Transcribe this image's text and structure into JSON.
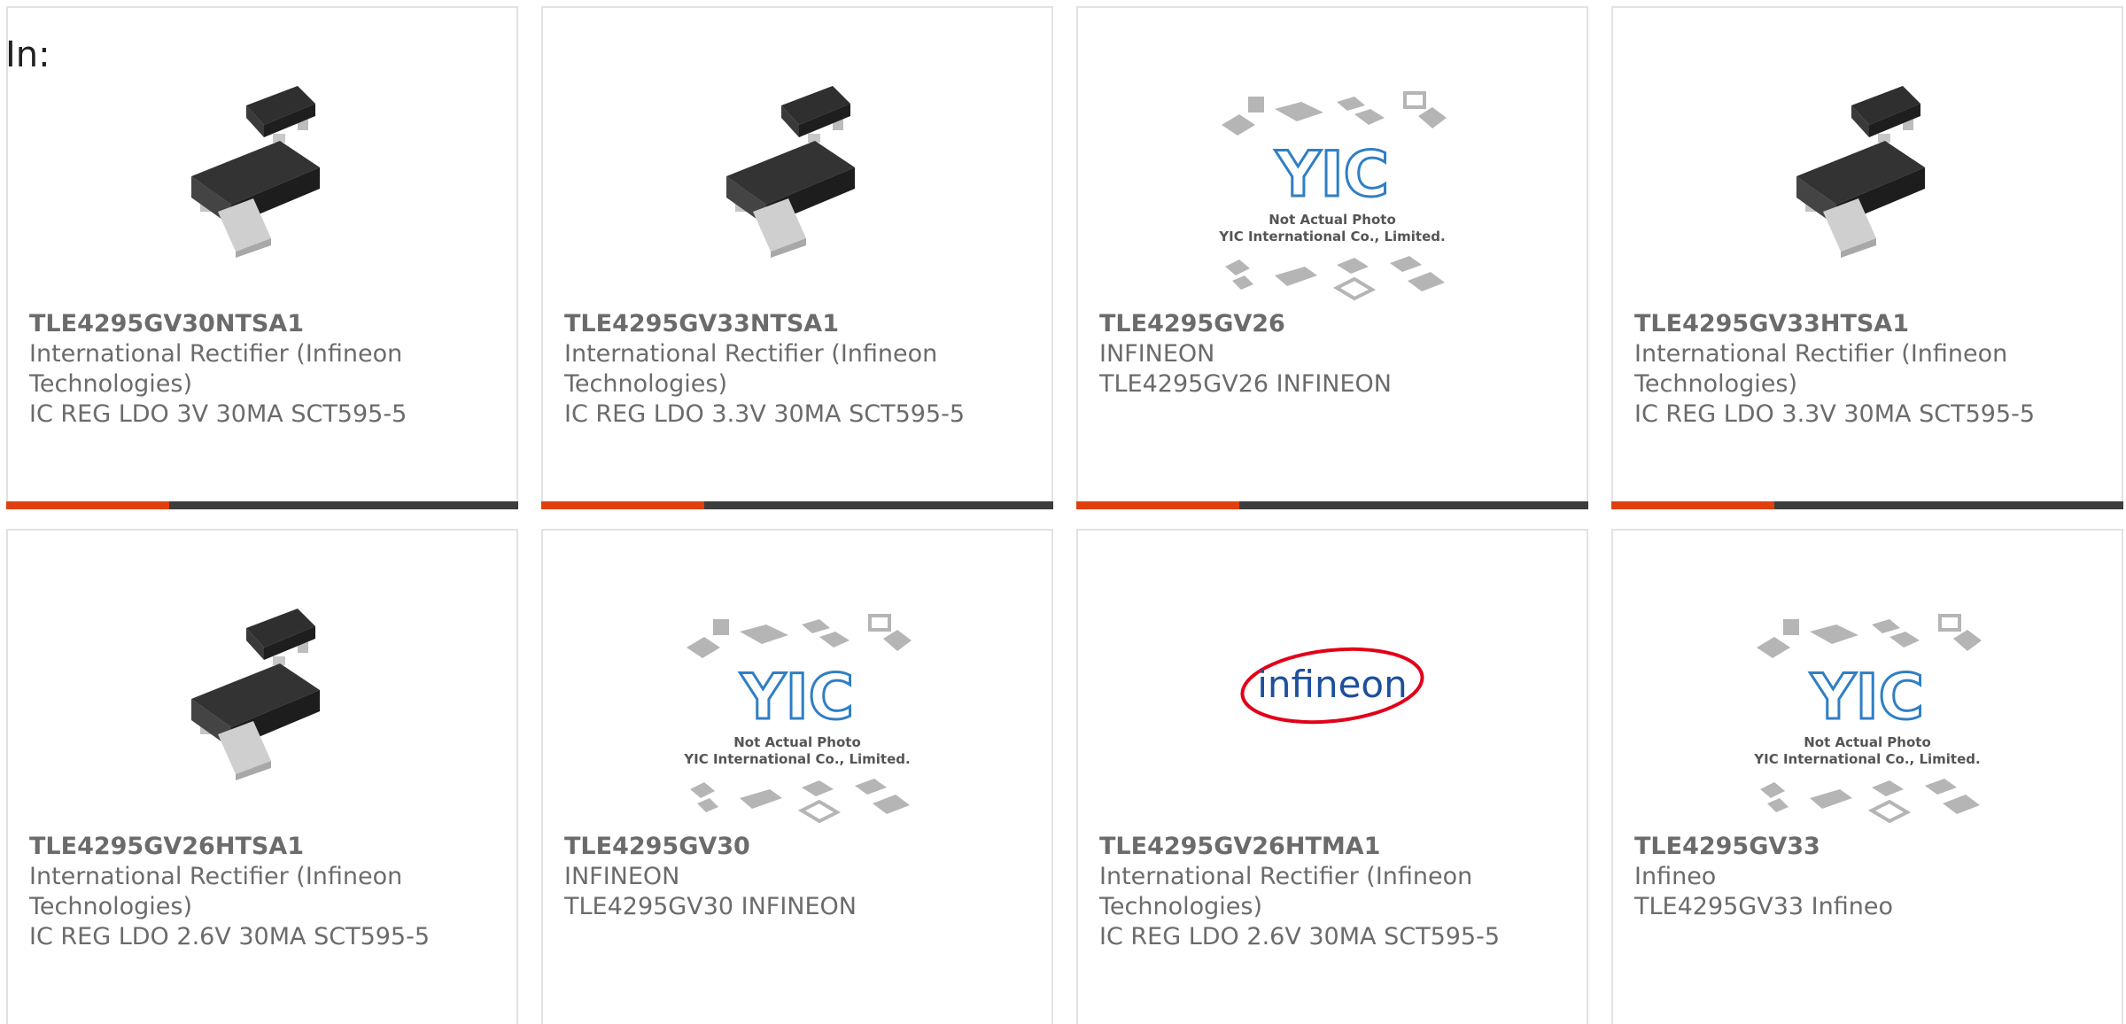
{
  "header": {
    "label": "In:"
  },
  "colors": {
    "accent": "#e0400f",
    "bar": "#3d3d3d",
    "text": "#6b6b6b"
  },
  "cards": [
    {
      "part": "TLE4295GV30NTSA1",
      "manufacturer": "International Rectifier (Infineon Technologies)",
      "description": "IC REG LDO 3V 30MA SCT595-5",
      "image": "sct595-package-photo"
    },
    {
      "part": "TLE4295GV33NTSA1",
      "manufacturer": "International Rectifier (Infineon Technologies)",
      "description": "IC REG LDO 3.3V 30MA SCT595-5",
      "image": "sct595-package-photo"
    },
    {
      "part": "TLE4295GV26",
      "manufacturer": "INFINEON",
      "description": "TLE4295GV26 INFINEON",
      "image": "yic-placeholder",
      "placeholder_line1": "Not Actual Photo",
      "placeholder_line2": "YIC International Co., Limited."
    },
    {
      "part": "TLE4295GV33HTSA1",
      "manufacturer": "International Rectifier (Infineon Technologies)",
      "description": "IC REG LDO 3.3V 30MA SCT595-5",
      "image": "sct595-package-photo"
    },
    {
      "part": "TLE4295GV26HTSA1",
      "manufacturer": "International Rectifier (Infineon Technologies)",
      "description": "IC REG LDO 2.6V 30MA SCT595-5",
      "image": "sct595-package-photo"
    },
    {
      "part": "TLE4295GV30",
      "manufacturer": "INFINEON",
      "description": "TLE4295GV30 INFINEON",
      "image": "yic-placeholder",
      "placeholder_line1": "Not Actual Photo",
      "placeholder_line2": "YIC International Co., Limited."
    },
    {
      "part": "TLE4295GV26HTMA1",
      "manufacturer": "International Rectifier (Infineon Technologies)",
      "description": "IC REG LDO 2.6V 30MA SCT595-5",
      "image": "infineon-logo",
      "logo_text": "infineon"
    },
    {
      "part": "TLE4295GV33",
      "manufacturer": "Infineo",
      "description": "TLE4295GV33 Infineo",
      "image": "yic-placeholder",
      "placeholder_line1": "Not Actual Photo",
      "placeholder_line2": "YIC International Co., Limited."
    }
  ]
}
